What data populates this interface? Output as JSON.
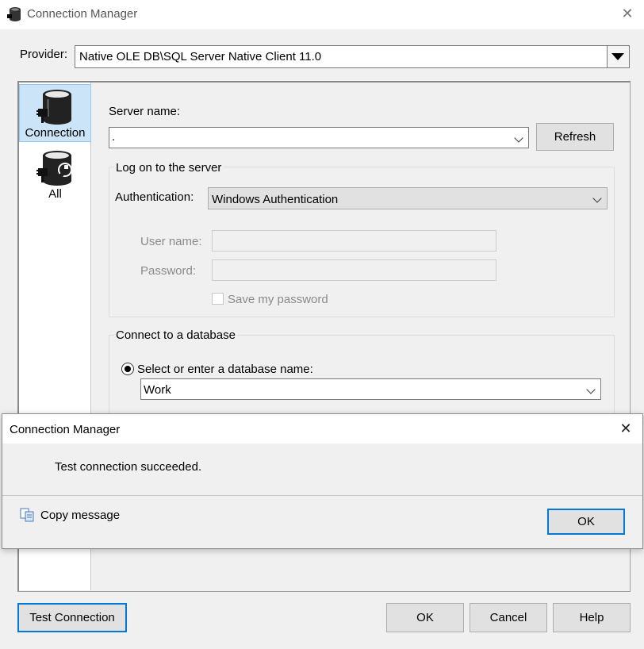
{
  "window": {
    "title": "Connection Manager",
    "close_glyph": "✕",
    "icon": "database-icon"
  },
  "provider": {
    "label": "Provider:",
    "value": "Native OLE DB\\SQL Server Native Client 11.0"
  },
  "sidebar": {
    "items": [
      {
        "label": "Connection",
        "icon": "database-plug-icon",
        "selected": true
      },
      {
        "label": "All",
        "icon": "database-wrench-icon",
        "selected": false
      }
    ]
  },
  "server": {
    "label": "Server name:",
    "value": ".",
    "refresh_label": "Refresh"
  },
  "logon": {
    "group_title": "Log on to the server",
    "auth_label": "Authentication:",
    "auth_value": "Windows Authentication",
    "username_label": "User name:",
    "username_value": "",
    "password_label": "Password:",
    "password_value": "",
    "save_password_label": "Save my password"
  },
  "database": {
    "group_title": "Connect to a database",
    "select_label": "Select or enter a database name:",
    "value": "Work"
  },
  "footer": {
    "test_connection_label": "Test Connection",
    "ok_label": "OK",
    "cancel_label": "Cancel",
    "help_label": "Help"
  },
  "dialog": {
    "title": "Connection Manager",
    "close_glyph": "✕",
    "message": "Test connection succeeded.",
    "copy_label": "Copy message",
    "ok_label": "OK",
    "copy_icon": "copy-icon"
  },
  "colors": {
    "accent": "#0078d7",
    "selection": "#cce4f7"
  }
}
